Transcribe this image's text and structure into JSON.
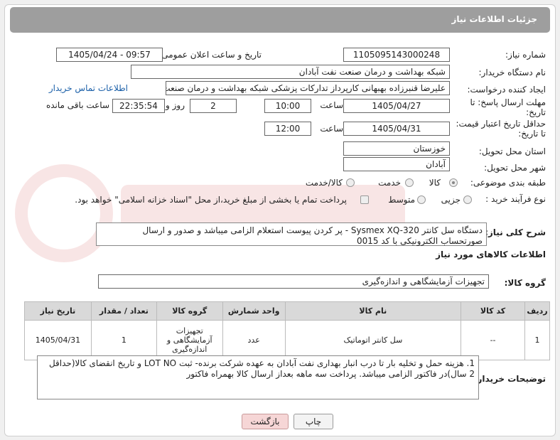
{
  "header": {
    "title": "جزئیات اطلاعات نیاز"
  },
  "fields": {
    "need_number_label": "شماره نیاز:",
    "need_number": "1105095143000248",
    "announce_label": "تاریخ و ساعت اعلان عمومی:",
    "announce_value": "1405/04/24 - 09:57",
    "buyer_org_label": "نام دستگاه خریدار:",
    "buyer_org": "شبکه بهداشت و درمان صنعت نفت آبادان",
    "creator_label": "ایجاد کننده درخواست:",
    "creator": "علیرضا قنبرزاده بهبهانی کارپرداز تدارکات پزشکی شبکه بهداشت و درمان صنعت",
    "contact_link": "اطلاعات تماس خریدار",
    "deadline_label_1": "مهلت ارسال پاسخ: تا",
    "deadline_label_2": "تاریخ:",
    "deadline_date": "1405/04/27",
    "time_label": "ساعت",
    "deadline_time": "10:00",
    "days_value": "2",
    "days_label": "روز و",
    "remaining_time": "22:35:54",
    "remaining_label": "ساعت باقی مانده",
    "price_label_1": "حداقل تاریخ اعتبار قیمت:",
    "price_label_2": "تا تاریخ:",
    "price_date": "1405/04/31",
    "price_time_label": "ساعت",
    "price_time": "12:00",
    "province_label": "استان محل تحویل:",
    "province": "خوزستان",
    "city_label": "شهر محل تحویل:",
    "city": "آبادان",
    "category_label": "طبقه بندی موضوعی:",
    "category_options": [
      "کالا",
      "خدمت",
      "کالا/خدمت"
    ],
    "process_label": "نوع فرآیند خرید :",
    "process_options": [
      "جزیی",
      "متوسط"
    ],
    "payment_note": "پرداخت تمام یا بخشی از مبلغ خرید،از محل \"اسناد خزانه اسلامی\" خواهد بود."
  },
  "need_description": {
    "label": "شرح کلی نیاز:",
    "text": "دستگاه سل کانتر Sysmex XQ-320  - پر کردن پیوست استعلام الزامی میباشد و  صدور  و ارسال صورتحساب الکترونیکی با کد 0015"
  },
  "goods_info": {
    "title": "اطلاعات کالاهای مورد نیاز",
    "group_label": "گروه کالا:",
    "group_value": "تجهیزات آزمایشگاهی و اندازه‌گیری"
  },
  "table": {
    "headers": [
      "ردیف",
      "کد کالا",
      "نام کالا",
      "واحد شمارش",
      "گروه کالا",
      "تعداد / مقدار",
      "تاریخ نیاز"
    ],
    "rows": [
      [
        "1",
        "--",
        "سل کانتر اتوماتیک",
        "عدد",
        "تجهیزات آزمایشگاهی و اندازه‌گیری",
        "1",
        "1405/04/31"
      ]
    ]
  },
  "buyer_notes": {
    "label": "توضیحات خریدار:",
    "text": "1.     هزینه حمل و تخلیه بار تا درب انبار بهداری نفت آبادان به عهده شرکت برنده- ثبت LOT NO و تاریخ انقضای کالا(حداقل 2 سال)در فاکتور الزامی میباشد. پرداخت سه ماهه بعداز ارسال کالا بهمراه فاکتور"
  },
  "buttons": {
    "print": "چاپ",
    "back": "بازگشت"
  },
  "colors": {
    "header_bg": "#9e9e9e",
    "link": "#1a5fa8",
    "back_button": "#f6d6d6"
  }
}
